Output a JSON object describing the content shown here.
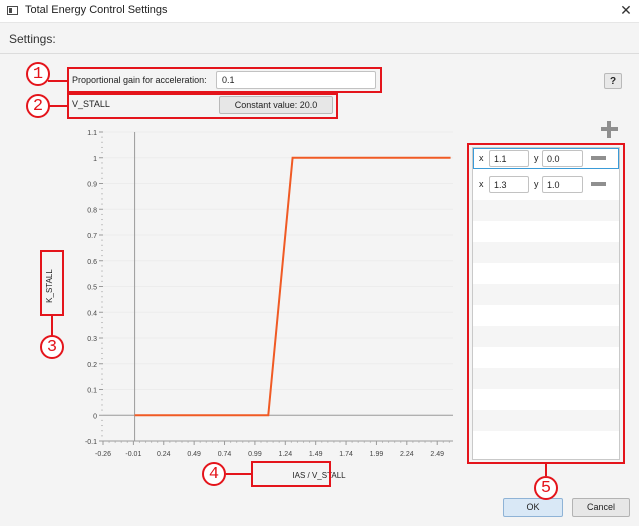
{
  "window": {
    "title": "Total Energy Control Settings",
    "close_glyph": "✕"
  },
  "settings_label": "Settings:",
  "help_label": "?",
  "gain": {
    "label": "Proportional gain for acceleration:",
    "value": "0.1"
  },
  "vstall": {
    "label": "V_STALL",
    "button_label": "Constant value: 20.0"
  },
  "annotations": {
    "n1": "1",
    "n2": "2",
    "n3": "3",
    "n4": "4",
    "n5": "5"
  },
  "chart_data": {
    "type": "line",
    "xlabel": "IAS / V_STALL",
    "ylabel": "K_STALL",
    "xlim": [
      -0.26,
      2.62
    ],
    "ylim": [
      -0.1,
      1.1
    ],
    "xticks": [
      -0.26,
      -0.01,
      0.24,
      0.49,
      0.74,
      0.99,
      1.24,
      1.49,
      1.74,
      1.99,
      2.24,
      2.49
    ],
    "xtick_labels": [
      "-0.26",
      "-0.01",
      "0.24",
      "0.49",
      "0.74",
      "0.99",
      "1.24",
      "1.49",
      "1.74",
      "1.99",
      "2.24",
      "2.49"
    ],
    "yticks": [
      -0.1,
      0,
      0.1,
      0.2,
      0.3,
      0.4,
      0.5,
      0.6,
      0.7,
      0.8,
      0.9,
      1,
      1.1
    ],
    "ytick_labels": [
      "-0.1",
      "0",
      "0.1",
      "0.2",
      "0.3",
      "0.4",
      "0.5",
      "0.6",
      "0.7",
      "0.8",
      "0.9",
      "1",
      "1.1"
    ],
    "series": [
      {
        "x": [
          0,
          1.1,
          1.3,
          2.6
        ],
        "y": [
          0,
          0,
          1,
          1
        ],
        "color": "#f05a24"
      }
    ]
  },
  "points": [
    {
      "x_label": "x",
      "x": "1.1",
      "y_label": "y",
      "y": "0.0"
    },
    {
      "x_label": "x",
      "x": "1.3",
      "y_label": "y",
      "y": "1.0"
    }
  ],
  "buttons": {
    "ok": "OK",
    "cancel": "Cancel"
  }
}
